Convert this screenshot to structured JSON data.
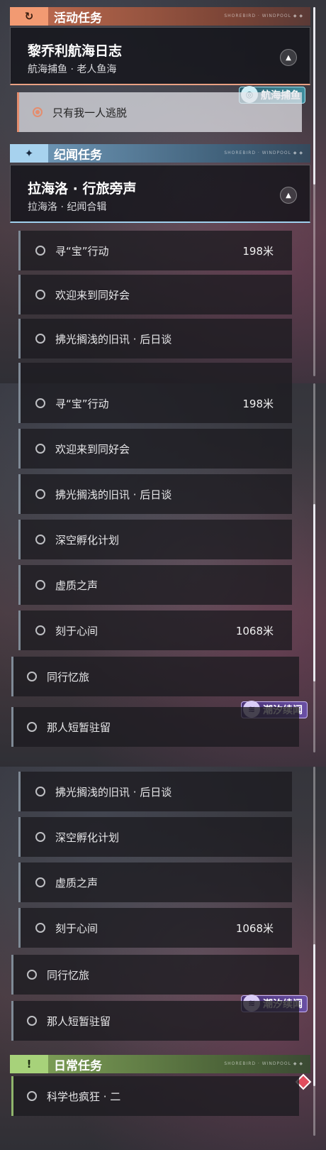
{
  "sections": {
    "activity": {
      "badge_icon": "refresh-icon",
      "title": "活动任务",
      "deco": "SHOREBIRD · WINDPOOL ◆ ◆"
    },
    "chronicle": {
      "badge_icon": "sparkle-icon",
      "title": "纪闻任务",
      "deco": "SHOREBIRD · WINDPOOL ◆ ◆"
    },
    "daily": {
      "badge_icon": "exclamation-icon",
      "title": "日常任务",
      "deco": "SHOREBIRD · WINDPOOL ◆ ◆"
    }
  },
  "quests": {
    "fishing": {
      "name": "黎乔利航海日志",
      "sub": "航海捕鱼 · 老人鱼海"
    },
    "lahailuo": {
      "name": "拉海洛 · 行旅旁声",
      "sub": "拉海洛 · 纪闻合辑"
    }
  },
  "tags": {
    "fishing": "航海捕鱼",
    "tide": "潮汐续闻"
  },
  "caret": "▲",
  "panel1": {
    "selected": "只有我一人逃脱",
    "rows": [
      {
        "label": "寻“宝”行动",
        "dist": "198米"
      },
      {
        "label": "欢迎来到同好会",
        "dist": ""
      },
      {
        "label": "拂光搁浅的旧讯 · 后日谈",
        "dist": ""
      }
    ]
  },
  "panel2": {
    "rows": [
      {
        "label": "寻“宝”行动",
        "dist": "198米"
      },
      {
        "label": "欢迎来到同好会",
        "dist": ""
      },
      {
        "label": "拂光搁浅的旧讯 · 后日谈",
        "dist": ""
      },
      {
        "label": "深空孵化计划",
        "dist": ""
      },
      {
        "label": "虚质之声",
        "dist": ""
      },
      {
        "label": "刻于心间",
        "dist": "1068米"
      }
    ],
    "outer": [
      "同行忆旅",
      "那人短暂驻留"
    ]
  },
  "panel3": {
    "rows": [
      {
        "label": "拂光搁浅的旧讯 · 后日谈",
        "dist": ""
      },
      {
        "label": "深空孵化计划",
        "dist": ""
      },
      {
        "label": "虚质之声",
        "dist": ""
      },
      {
        "label": "刻于心间",
        "dist": "1068米"
      }
    ],
    "outer": [
      "同行忆旅",
      "那人短暂驻留"
    ],
    "daily": "科学也疯狂 · 二"
  }
}
